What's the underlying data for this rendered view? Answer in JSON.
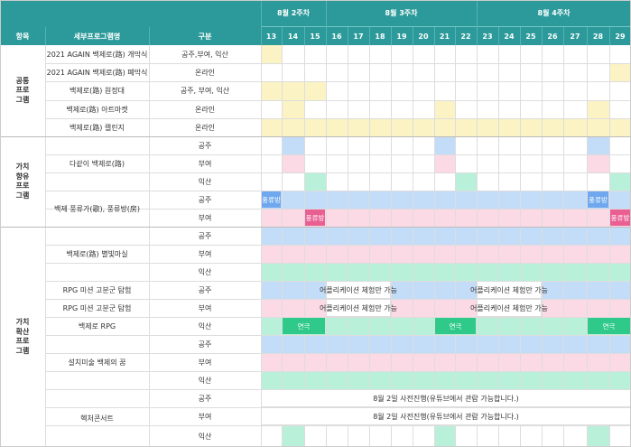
{
  "weeks": [
    "8월 2주차",
    "8월 3주차",
    "8월 4주차"
  ],
  "headers": {
    "category": "항목",
    "program": "세부프로그램명",
    "region": "구분"
  },
  "days": [
    "13",
    "14",
    "15",
    "16",
    "17",
    "18",
    "19",
    "20",
    "21",
    "22",
    "23",
    "24",
    "25",
    "26",
    "27",
    "28",
    "29"
  ],
  "categories": [
    {
      "label": "공통\n프로\n그램"
    },
    {
      "label": "가치\n향유\n프로\n그램"
    },
    {
      "label": "가치\n확산\n프로\n그램"
    }
  ],
  "programs": [
    "2021 AGAIN 백제로(路) 개막식",
    "2021 AGAIN 백제로(路) 폐막식",
    "백제로(路) 원정대",
    "백제로(路) 아트마켓",
    "백제로(路) 캘린지",
    "다같이 백제로(路)",
    "백제 풍류가(歌), 풍류방(房)",
    "백제로(路) 별빛마실",
    "RPG 미션 고분군 탐험",
    "RPG 미션 고분군 탐험",
    "백제로 RPG",
    "설치미술 백제의 꿈",
    "헥처콘서트"
  ],
  "regions": [
    "공주,부여, 익산",
    "온라인",
    "공주, 부여, 익산",
    "온라인",
    "온라인",
    "공주",
    "부여",
    "익산",
    "공주",
    "부여",
    "공주",
    "부여",
    "익산",
    "공주",
    "부여",
    "익산",
    "공주",
    "부여",
    "익산",
    "공주",
    "부여",
    "익산"
  ],
  "tags": {
    "pungryu_bang": "풍류방",
    "pungryu_bang2": "풍류방",
    "theater": "연극"
  },
  "notes": {
    "app_experience": "어플리케이션 체험만 가능",
    "advance": "8월 2일 사전진행(유튜브에서 관람 가능합니다.)"
  },
  "colors": {
    "header": "#2c9a9a",
    "yellow": "#fbf3c4",
    "blue": "#c3dcf8",
    "pink": "#fbd9e5",
    "green": "#b9f0da",
    "tag_blue": "#6fa8ee",
    "tag_pink": "#ea5f92",
    "tag_green": "#2fc98a"
  }
}
